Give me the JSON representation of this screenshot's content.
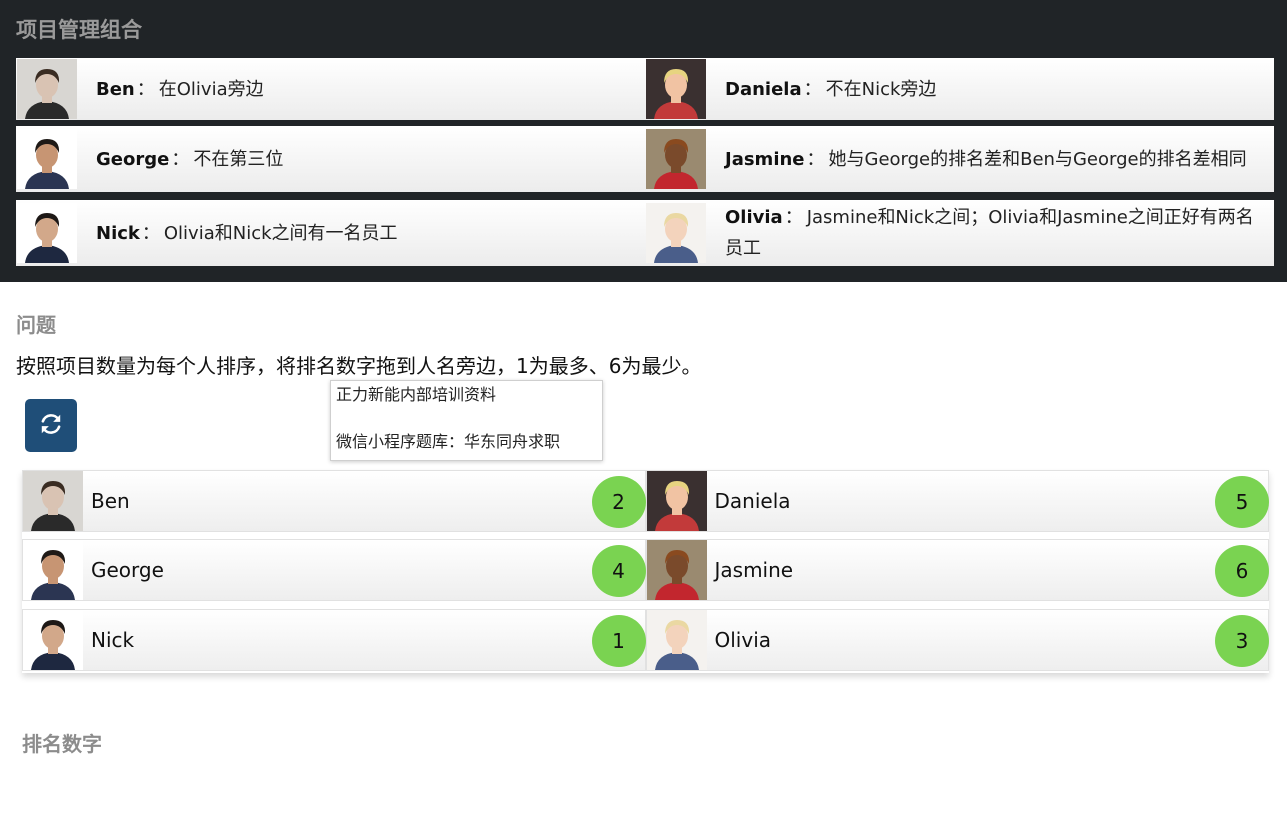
{
  "panel": {
    "title": "项目管理组合",
    "separator": "："
  },
  "clues": [
    [
      {
        "name": "Ben",
        "text": "在Olivia旁边",
        "photo": {
          "skin": "#d9c3b3",
          "hair": "#3a2c22",
          "bg": "#d8d6d2",
          "shirt": "#2a2a2a"
        }
      },
      {
        "name": "Daniela",
        "text": "不在Nick旁边",
        "photo": {
          "skin": "#f1c3a3",
          "hair": "#e7d480",
          "bg": "#3a3030",
          "shirt": "#c23a3a"
        }
      }
    ],
    [
      {
        "name": "George",
        "text": "不在第三位",
        "photo": {
          "skin": "#c79573",
          "hair": "#1f1a17",
          "bg": "#ffffff",
          "shirt": "#2b3552"
        }
      },
      {
        "name": "Jasmine",
        "text": "她与George的排名差和Ben与George的排名差相同",
        "photo": {
          "skin": "#7a4a2b",
          "hair": "#8a4a1f",
          "bg": "#9a8a70",
          "shirt": "#c2262e"
        }
      }
    ],
    [
      {
        "name": "Nick",
        "text": "Olivia和Nick之间有一名员工",
        "photo": {
          "skin": "#d2a88a",
          "hair": "#1d1816",
          "bg": "#ffffff",
          "shirt": "#1e2840"
        }
      },
      {
        "name": "Olivia",
        "text": "Jasmine和Nick之间；Olivia和Jasmine之间正好有两名员工",
        "photo": {
          "skin": "#f3d3bc",
          "hair": "#ead8a2",
          "bg": "#f4f2ef",
          "shirt": "#4a5e8a"
        }
      }
    ]
  ],
  "question": {
    "heading": "问题",
    "text": "按照项目数量为每个人排序，将排名数字拖到人名旁边，1为最多、6为最少。"
  },
  "popup": {
    "line1": "正力新能内部培训资料",
    "line2": "微信小程序题库：华东同舟求职"
  },
  "reset_icon": "refresh-icon",
  "answers": [
    [
      {
        "name": "Ben",
        "rank": "2"
      },
      {
        "name": "Daniela",
        "rank": "5"
      }
    ],
    [
      {
        "name": "George",
        "rank": "4"
      },
      {
        "name": "Jasmine",
        "rank": "6"
      }
    ],
    [
      {
        "name": "Nick",
        "rank": "1"
      },
      {
        "name": "Olivia",
        "rank": "3"
      }
    ]
  ],
  "rank_heading": "排名数字",
  "colors": {
    "panel_bg": "#202427",
    "badge": "#7ad351",
    "reset_button": "#1f4e78"
  }
}
